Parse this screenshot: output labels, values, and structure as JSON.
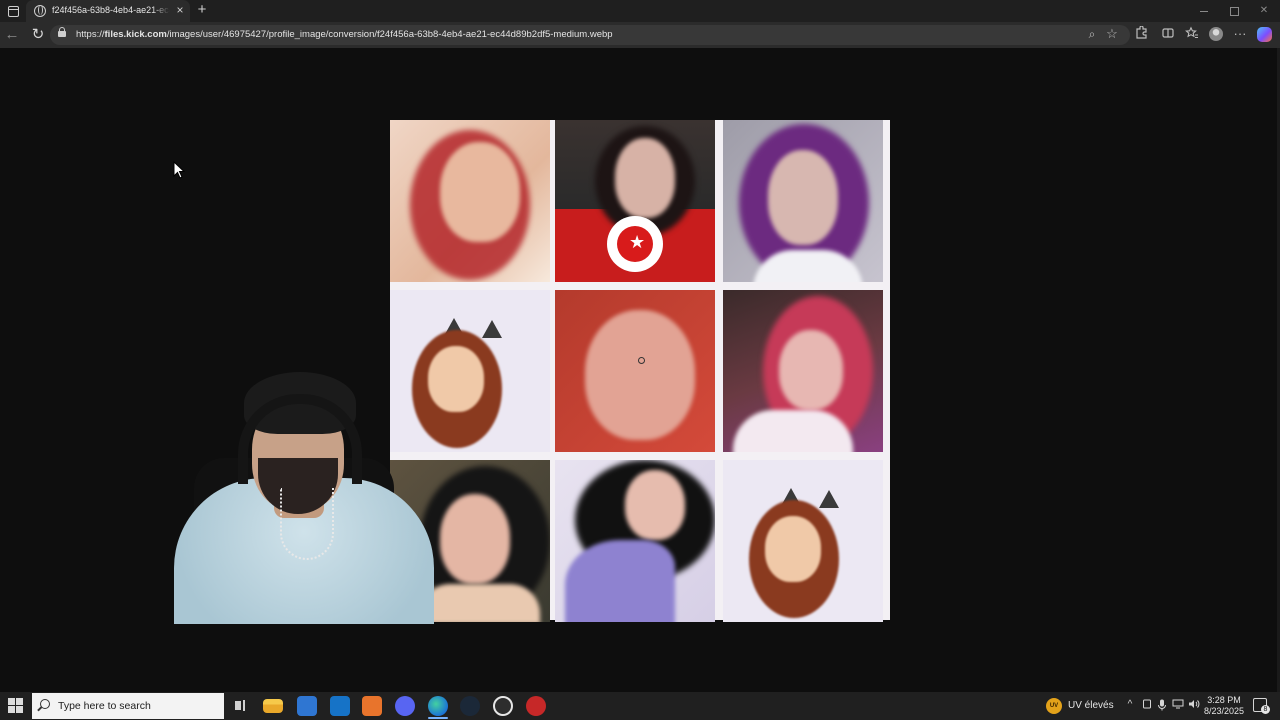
{
  "browser": {
    "tab_title": "f24f456a-63b8-4eb4-ae21-ec44d89b2df5-medium.webp",
    "tab_close_glyph": "×",
    "new_tab_glyph": "+",
    "url_prefix": "https://",
    "url_host": "files.kick.com",
    "url_path": "/images/user/46975427/profile_image/conversion/f24f456a-63b8-4eb4-ae21-ec44d89b2df5-medium.webp",
    "back_glyph": "←",
    "reload_glyph": "↻",
    "zoom_glyph": "⌕",
    "star_glyph": "☆",
    "more_glyph": "···",
    "icons": [
      "tab-actions-icon",
      "globe-icon",
      "lock-icon",
      "zoom-icon",
      "star-icon",
      "extensions-icon",
      "split-screen-icon",
      "favorites-icon",
      "profile-icon",
      "more-icon",
      "copilot-icon"
    ]
  },
  "page": {
    "background": "#0e0e0e",
    "grid_background": "#f3f0f4",
    "image_grid_cells": [
      {
        "bg": "#e9c9b5",
        "accent": "#b4272b"
      },
      {
        "bg": "#2a2a2a",
        "accent": "#c81d1d"
      },
      {
        "bg": "#b7b5c0",
        "accent": "#6c2a80"
      },
      {
        "bg": "#ece8f3",
        "accent": "#8a3a1f"
      },
      {
        "bg": "#b43a2c",
        "accent": "#d44a3a"
      },
      {
        "bg": "#6a3a42",
        "accent": "#c63a58"
      },
      {
        "bg": "#3a3a30",
        "accent": "#151515"
      },
      {
        "bg": "#d6cfe6",
        "accent": "#8e82d0"
      },
      {
        "bg": "#ece8f3",
        "accent": "#8a3a1f"
      }
    ]
  },
  "taskbar": {
    "search_placeholder": "Type here to search",
    "weather_badge": "UV",
    "weather_text": "UV élevés",
    "tray_chevron": "^",
    "clock_time": "3:28 PM",
    "clock_date": "8/23/2025",
    "notification_count": "8",
    "apps": [
      "task-view-icon",
      "file-explorer-icon",
      "store-icon",
      "outlook-icon",
      "app-icon",
      "discord-icon",
      "edge-icon",
      "steam-icon",
      "app-icon",
      "app-icon"
    ]
  }
}
